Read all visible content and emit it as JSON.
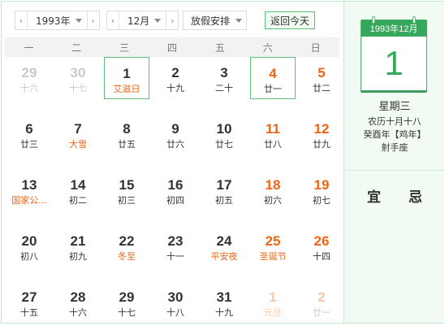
{
  "toolbar": {
    "year_label": "1993年",
    "month_label": "12月",
    "holiday_label": "放假安排",
    "today_label": "返回今天"
  },
  "weekdays": [
    "一",
    "二",
    "三",
    "四",
    "五",
    "六",
    "日"
  ],
  "days": [
    {
      "num": "29",
      "lunar": "十六",
      "other": true
    },
    {
      "num": "30",
      "lunar": "十七",
      "other": true
    },
    {
      "num": "1",
      "lunar": "艾滋日",
      "fest": true,
      "boxed": true
    },
    {
      "num": "2",
      "lunar": "十九"
    },
    {
      "num": "3",
      "lunar": "二十"
    },
    {
      "num": "4",
      "lunar": "廿一",
      "weekend": true,
      "boxed": true
    },
    {
      "num": "5",
      "lunar": "廿二",
      "weekend": true
    },
    {
      "num": "6",
      "lunar": "廿三"
    },
    {
      "num": "7",
      "lunar": "大雪",
      "fest": true
    },
    {
      "num": "8",
      "lunar": "廿五"
    },
    {
      "num": "9",
      "lunar": "廿六"
    },
    {
      "num": "10",
      "lunar": "廿七"
    },
    {
      "num": "11",
      "lunar": "廿八",
      "weekend": true
    },
    {
      "num": "12",
      "lunar": "廿九",
      "weekend": true
    },
    {
      "num": "13",
      "lunar": "国家公...",
      "fest": true
    },
    {
      "num": "14",
      "lunar": "初二"
    },
    {
      "num": "15",
      "lunar": "初三"
    },
    {
      "num": "16",
      "lunar": "初四"
    },
    {
      "num": "17",
      "lunar": "初五"
    },
    {
      "num": "18",
      "lunar": "初六",
      "weekend": true
    },
    {
      "num": "19",
      "lunar": "初七",
      "weekend": true
    },
    {
      "num": "20",
      "lunar": "初八"
    },
    {
      "num": "21",
      "lunar": "初九"
    },
    {
      "num": "22",
      "lunar": "冬至",
      "fest": true
    },
    {
      "num": "23",
      "lunar": "十一"
    },
    {
      "num": "24",
      "lunar": "平安夜",
      "fest": true
    },
    {
      "num": "25",
      "lunar": "圣诞节",
      "weekend": true,
      "fest": true
    },
    {
      "num": "26",
      "lunar": "十四",
      "weekend": true
    },
    {
      "num": "27",
      "lunar": "十五"
    },
    {
      "num": "28",
      "lunar": "十六"
    },
    {
      "num": "29",
      "lunar": "十七"
    },
    {
      "num": "30",
      "lunar": "十八"
    },
    {
      "num": "31",
      "lunar": "十九"
    },
    {
      "num": "1",
      "lunar": "元旦",
      "other": true,
      "weekend": true,
      "fest": true
    },
    {
      "num": "2",
      "lunar": "廿一",
      "other": true,
      "weekend": true
    }
  ],
  "side": {
    "header": "1993年12月",
    "big_day": "1",
    "weekday": "星期三",
    "lunar_date": "农历十月十八",
    "ganzhi": "癸酉年【鸡年】",
    "zodiac": "射手座",
    "yi": "宜",
    "ji": "忌"
  },
  "colors": {
    "accent_green": "#35a85b",
    "weekend_orange": "#f06415",
    "panel_bg": "#f1fbf4"
  }
}
